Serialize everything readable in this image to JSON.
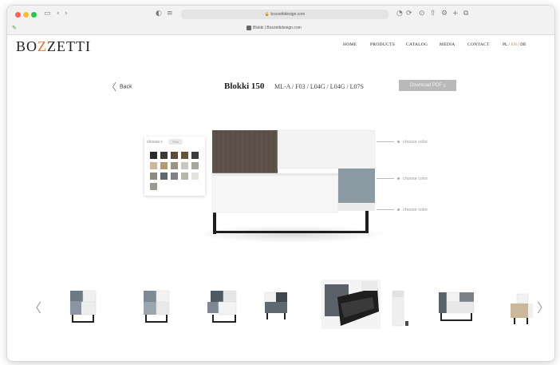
{
  "browser": {
    "url": "bozzettidesign.com",
    "tab_title": "Blokki | Bozzettidesign.com"
  },
  "site": {
    "logo_pre": "BO",
    "logo_accent": "Z",
    "logo_post": "ZETTI",
    "nav": [
      "HOME",
      "PRODUCTS",
      "CATALOG",
      "MEDIA",
      "CONTACT"
    ],
    "lang_pl": "PL",
    "lang_sep1": " / ",
    "lang_en": "EN",
    "lang_sep2": " / ",
    "lang_de": "DE"
  },
  "product": {
    "back_label": "Back",
    "name": "Blokki 150",
    "codes": "ML-A  /  F03 / L04G / L04G / L07S",
    "download_label": "Download PDF"
  },
  "configurator": {
    "choose_color": "choose color",
    "picker_label": "choose c",
    "picker_pill": "Pick",
    "swatches": [
      "#2b2b2b",
      "#3e3a36",
      "#5a4a3a",
      "#6a5236",
      "#3b3b3b",
      "#c9b99a",
      "#b79a6a",
      "#9a9483",
      "#c7c7c4",
      "#a7a59e",
      "#8d8a82",
      "#5c6b70",
      "#7f8386",
      "#b5b7a8",
      "#e4e3df",
      "#9d9a93"
    ],
    "colors": {
      "top_left": "#5d5149",
      "top_right": "#f1f1f1",
      "bottom_left": "#f5f5f5",
      "bottom_right": "#8c9ba3",
      "accent": "#e7722d"
    }
  },
  "gallery": {
    "count": 8
  }
}
